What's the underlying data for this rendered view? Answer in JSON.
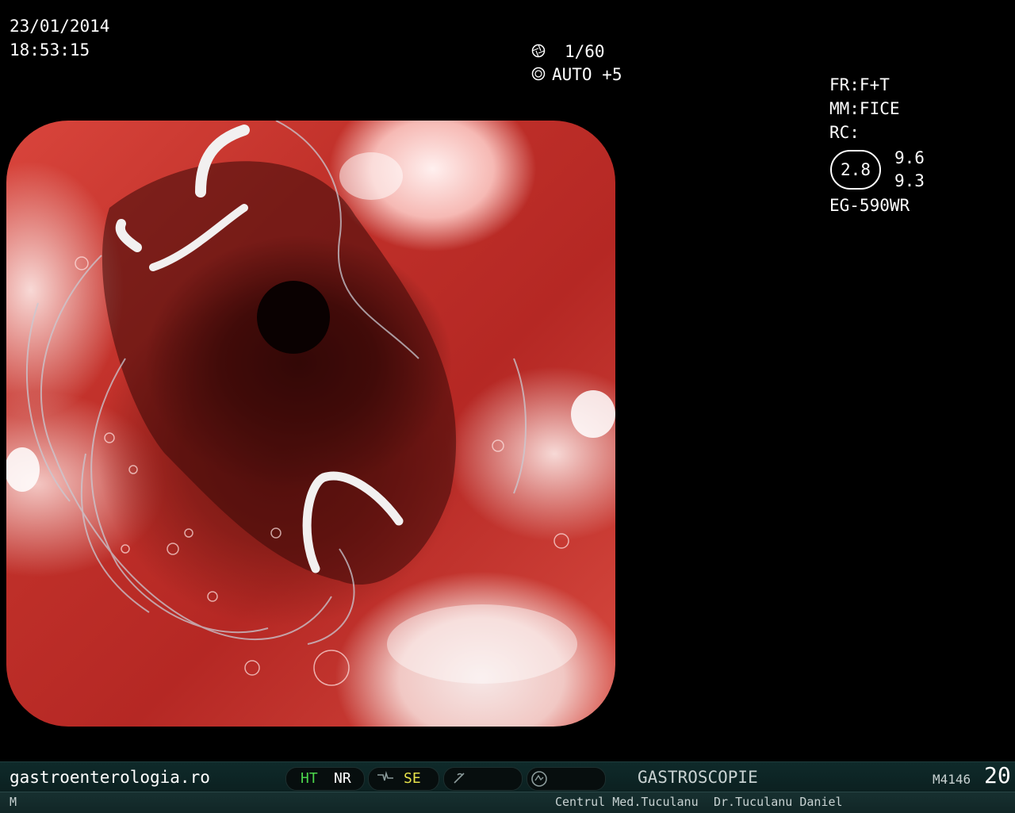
{
  "header": {
    "date": "23/01/2014",
    "time": "18:53:15"
  },
  "exposure": {
    "shutter": "1/60",
    "mode": "AUTO +5",
    "shutter_icon": "shutter-icon",
    "iris_icon": "iris-icon"
  },
  "settings": {
    "fr": "FR:F+T",
    "mm": "MM:FICE",
    "rc": "RC:",
    "circle_value": "2.8",
    "value_top": "9.6",
    "value_bottom": "9.3",
    "scope_model": "EG-590WR"
  },
  "status_bar": {
    "website": "gastroenterologia.ro",
    "ht": "HT",
    "nr": "NR",
    "se": "SE",
    "procedure": "GASTROSCOPIE",
    "code": "M4146",
    "number": "20",
    "icons": [
      "structure-enhance-icon",
      "freeze-icon",
      "record-icon"
    ]
  },
  "footer": {
    "mode": "M",
    "clinic": "Centrul Med.Tuculanu",
    "doctor": "Dr.Tuculanu Daniel"
  },
  "colors": {
    "ht_green": "#4bd44b",
    "se_yellow": "#e6e14a",
    "bar_bg": "#0f2a2a"
  }
}
